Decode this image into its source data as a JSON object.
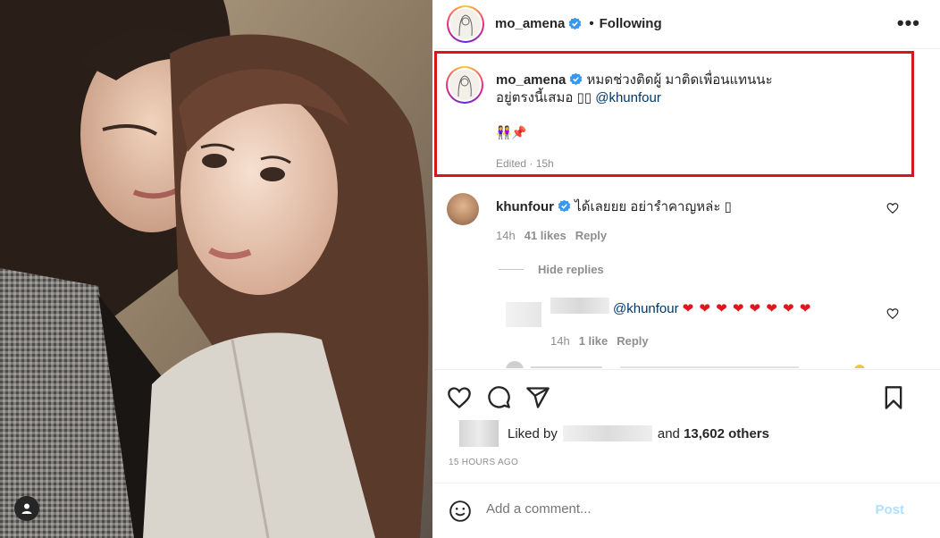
{
  "post": {
    "author": "mo_amena",
    "follow_separator": "•",
    "follow_status": "Following",
    "more_label": "•••"
  },
  "caption": {
    "username": "mo_amena",
    "text_line1": "หมดช่วงติดผู้ มาติดเพื่อนแทนนะ",
    "text_line2": "อยู่ตรงนี้เสมอ",
    "text_line2_glyphs": "▯▯",
    "mention": "@khunfour",
    "emoji_line": "👭📌",
    "meta": "Edited · 15h"
  },
  "comments": [
    {
      "username": "khunfour",
      "text": "ได้เลยยย อย่ารำคาญหล่ะ ▯",
      "time": "14h",
      "likes": "41 likes",
      "reply_label": "Reply"
    }
  ],
  "hide_replies_label": "Hide replies",
  "reply": {
    "mention": "@khunfour",
    "hearts": "❤ ❤ ❤ ❤ ❤ ❤ ❤ ❤",
    "time": "14h",
    "likes": "1 like",
    "reply_label": "Reply"
  },
  "likes": {
    "prefix": "Liked by",
    "and_text": "and",
    "others": "13,602 others"
  },
  "timestamp": "15 HOURS AGO",
  "add_comment": {
    "placeholder": "Add a comment...",
    "post_label": "Post"
  },
  "colors": {
    "highlight_border": "#d9141a",
    "verified_blue": "#3897f0",
    "mention_blue": "#00376b",
    "heart_red": "#e0161f",
    "post_disabled": "#b2dffc"
  }
}
